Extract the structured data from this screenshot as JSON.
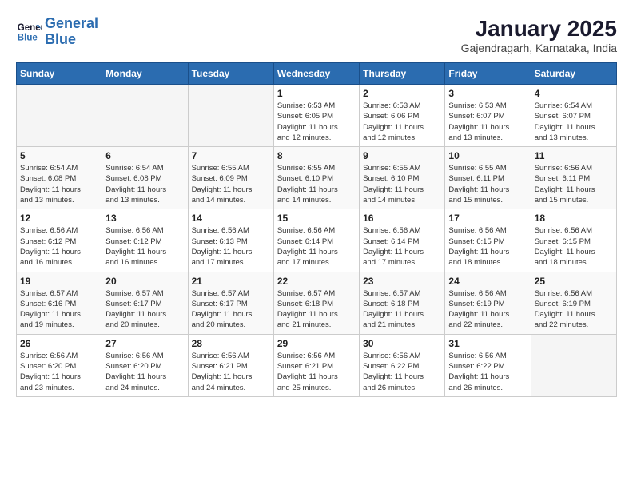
{
  "header": {
    "logo_line1": "General",
    "logo_line2": "Blue",
    "month": "January 2025",
    "location": "Gajendragarh, Karnataka, India"
  },
  "weekdays": [
    "Sunday",
    "Monday",
    "Tuesday",
    "Wednesday",
    "Thursday",
    "Friday",
    "Saturday"
  ],
  "weeks": [
    [
      {
        "day": "",
        "info": ""
      },
      {
        "day": "",
        "info": ""
      },
      {
        "day": "",
        "info": ""
      },
      {
        "day": "1",
        "info": "Sunrise: 6:53 AM\nSunset: 6:05 PM\nDaylight: 11 hours\nand 12 minutes."
      },
      {
        "day": "2",
        "info": "Sunrise: 6:53 AM\nSunset: 6:06 PM\nDaylight: 11 hours\nand 12 minutes."
      },
      {
        "day": "3",
        "info": "Sunrise: 6:53 AM\nSunset: 6:07 PM\nDaylight: 11 hours\nand 13 minutes."
      },
      {
        "day": "4",
        "info": "Sunrise: 6:54 AM\nSunset: 6:07 PM\nDaylight: 11 hours\nand 13 minutes."
      }
    ],
    [
      {
        "day": "5",
        "info": "Sunrise: 6:54 AM\nSunset: 6:08 PM\nDaylight: 11 hours\nand 13 minutes."
      },
      {
        "day": "6",
        "info": "Sunrise: 6:54 AM\nSunset: 6:08 PM\nDaylight: 11 hours\nand 13 minutes."
      },
      {
        "day": "7",
        "info": "Sunrise: 6:55 AM\nSunset: 6:09 PM\nDaylight: 11 hours\nand 14 minutes."
      },
      {
        "day": "8",
        "info": "Sunrise: 6:55 AM\nSunset: 6:10 PM\nDaylight: 11 hours\nand 14 minutes."
      },
      {
        "day": "9",
        "info": "Sunrise: 6:55 AM\nSunset: 6:10 PM\nDaylight: 11 hours\nand 14 minutes."
      },
      {
        "day": "10",
        "info": "Sunrise: 6:55 AM\nSunset: 6:11 PM\nDaylight: 11 hours\nand 15 minutes."
      },
      {
        "day": "11",
        "info": "Sunrise: 6:56 AM\nSunset: 6:11 PM\nDaylight: 11 hours\nand 15 minutes."
      }
    ],
    [
      {
        "day": "12",
        "info": "Sunrise: 6:56 AM\nSunset: 6:12 PM\nDaylight: 11 hours\nand 16 minutes."
      },
      {
        "day": "13",
        "info": "Sunrise: 6:56 AM\nSunset: 6:12 PM\nDaylight: 11 hours\nand 16 minutes."
      },
      {
        "day": "14",
        "info": "Sunrise: 6:56 AM\nSunset: 6:13 PM\nDaylight: 11 hours\nand 17 minutes."
      },
      {
        "day": "15",
        "info": "Sunrise: 6:56 AM\nSunset: 6:14 PM\nDaylight: 11 hours\nand 17 minutes."
      },
      {
        "day": "16",
        "info": "Sunrise: 6:56 AM\nSunset: 6:14 PM\nDaylight: 11 hours\nand 17 minutes."
      },
      {
        "day": "17",
        "info": "Sunrise: 6:56 AM\nSunset: 6:15 PM\nDaylight: 11 hours\nand 18 minutes."
      },
      {
        "day": "18",
        "info": "Sunrise: 6:56 AM\nSunset: 6:15 PM\nDaylight: 11 hours\nand 18 minutes."
      }
    ],
    [
      {
        "day": "19",
        "info": "Sunrise: 6:57 AM\nSunset: 6:16 PM\nDaylight: 11 hours\nand 19 minutes."
      },
      {
        "day": "20",
        "info": "Sunrise: 6:57 AM\nSunset: 6:17 PM\nDaylight: 11 hours\nand 20 minutes."
      },
      {
        "day": "21",
        "info": "Sunrise: 6:57 AM\nSunset: 6:17 PM\nDaylight: 11 hours\nand 20 minutes."
      },
      {
        "day": "22",
        "info": "Sunrise: 6:57 AM\nSunset: 6:18 PM\nDaylight: 11 hours\nand 21 minutes."
      },
      {
        "day": "23",
        "info": "Sunrise: 6:57 AM\nSunset: 6:18 PM\nDaylight: 11 hours\nand 21 minutes."
      },
      {
        "day": "24",
        "info": "Sunrise: 6:56 AM\nSunset: 6:19 PM\nDaylight: 11 hours\nand 22 minutes."
      },
      {
        "day": "25",
        "info": "Sunrise: 6:56 AM\nSunset: 6:19 PM\nDaylight: 11 hours\nand 22 minutes."
      }
    ],
    [
      {
        "day": "26",
        "info": "Sunrise: 6:56 AM\nSunset: 6:20 PM\nDaylight: 11 hours\nand 23 minutes."
      },
      {
        "day": "27",
        "info": "Sunrise: 6:56 AM\nSunset: 6:20 PM\nDaylight: 11 hours\nand 24 minutes."
      },
      {
        "day": "28",
        "info": "Sunrise: 6:56 AM\nSunset: 6:21 PM\nDaylight: 11 hours\nand 24 minutes."
      },
      {
        "day": "29",
        "info": "Sunrise: 6:56 AM\nSunset: 6:21 PM\nDaylight: 11 hours\nand 25 minutes."
      },
      {
        "day": "30",
        "info": "Sunrise: 6:56 AM\nSunset: 6:22 PM\nDaylight: 11 hours\nand 26 minutes."
      },
      {
        "day": "31",
        "info": "Sunrise: 6:56 AM\nSunset: 6:22 PM\nDaylight: 11 hours\nand 26 minutes."
      },
      {
        "day": "",
        "info": ""
      }
    ]
  ]
}
